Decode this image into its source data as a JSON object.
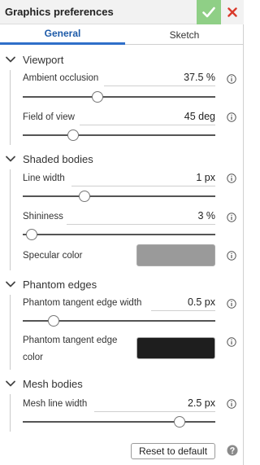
{
  "window": {
    "title": "Graphics preferences"
  },
  "tabs": [
    {
      "label": "General",
      "active": true
    },
    {
      "label": "Sketch",
      "active": false
    }
  ],
  "sections": {
    "viewport": {
      "title": "Viewport",
      "ambient_occlusion": {
        "label": "Ambient occlusion",
        "value": "37.5 %",
        "slider_fraction": 0.39
      },
      "field_of_view": {
        "label": "Field of view",
        "value": "45 deg",
        "slider_fraction": 0.26
      }
    },
    "shaded_bodies": {
      "title": "Shaded bodies",
      "line_width": {
        "label": "Line width",
        "value": "1 px",
        "slider_fraction": 0.32
      },
      "shininess": {
        "label": "Shininess",
        "value": "3 %",
        "slider_fraction": 0.045
      },
      "specular_color": {
        "label": "Specular color",
        "color": "#9a9a9a"
      }
    },
    "phantom_edges": {
      "title": "Phantom edges",
      "tangent_edge_width": {
        "label": "Phantom tangent edge width",
        "value": "0.5 px",
        "slider_fraction": 0.16
      },
      "tangent_edge_color": {
        "label_line1": "Phantom tangent edge",
        "label_line2": "color",
        "color": "#1e1e1e"
      }
    },
    "mesh_bodies": {
      "title": "Mesh bodies",
      "mesh_line_width": {
        "label": "Mesh line width",
        "value": "2.5 px",
        "slider_fraction": 0.815
      }
    }
  },
  "footer": {
    "reset_label": "Reset to default"
  },
  "colors": {
    "accent": "#2f6fc9",
    "accept": "#8fcf86",
    "close": "#d93a2b"
  }
}
